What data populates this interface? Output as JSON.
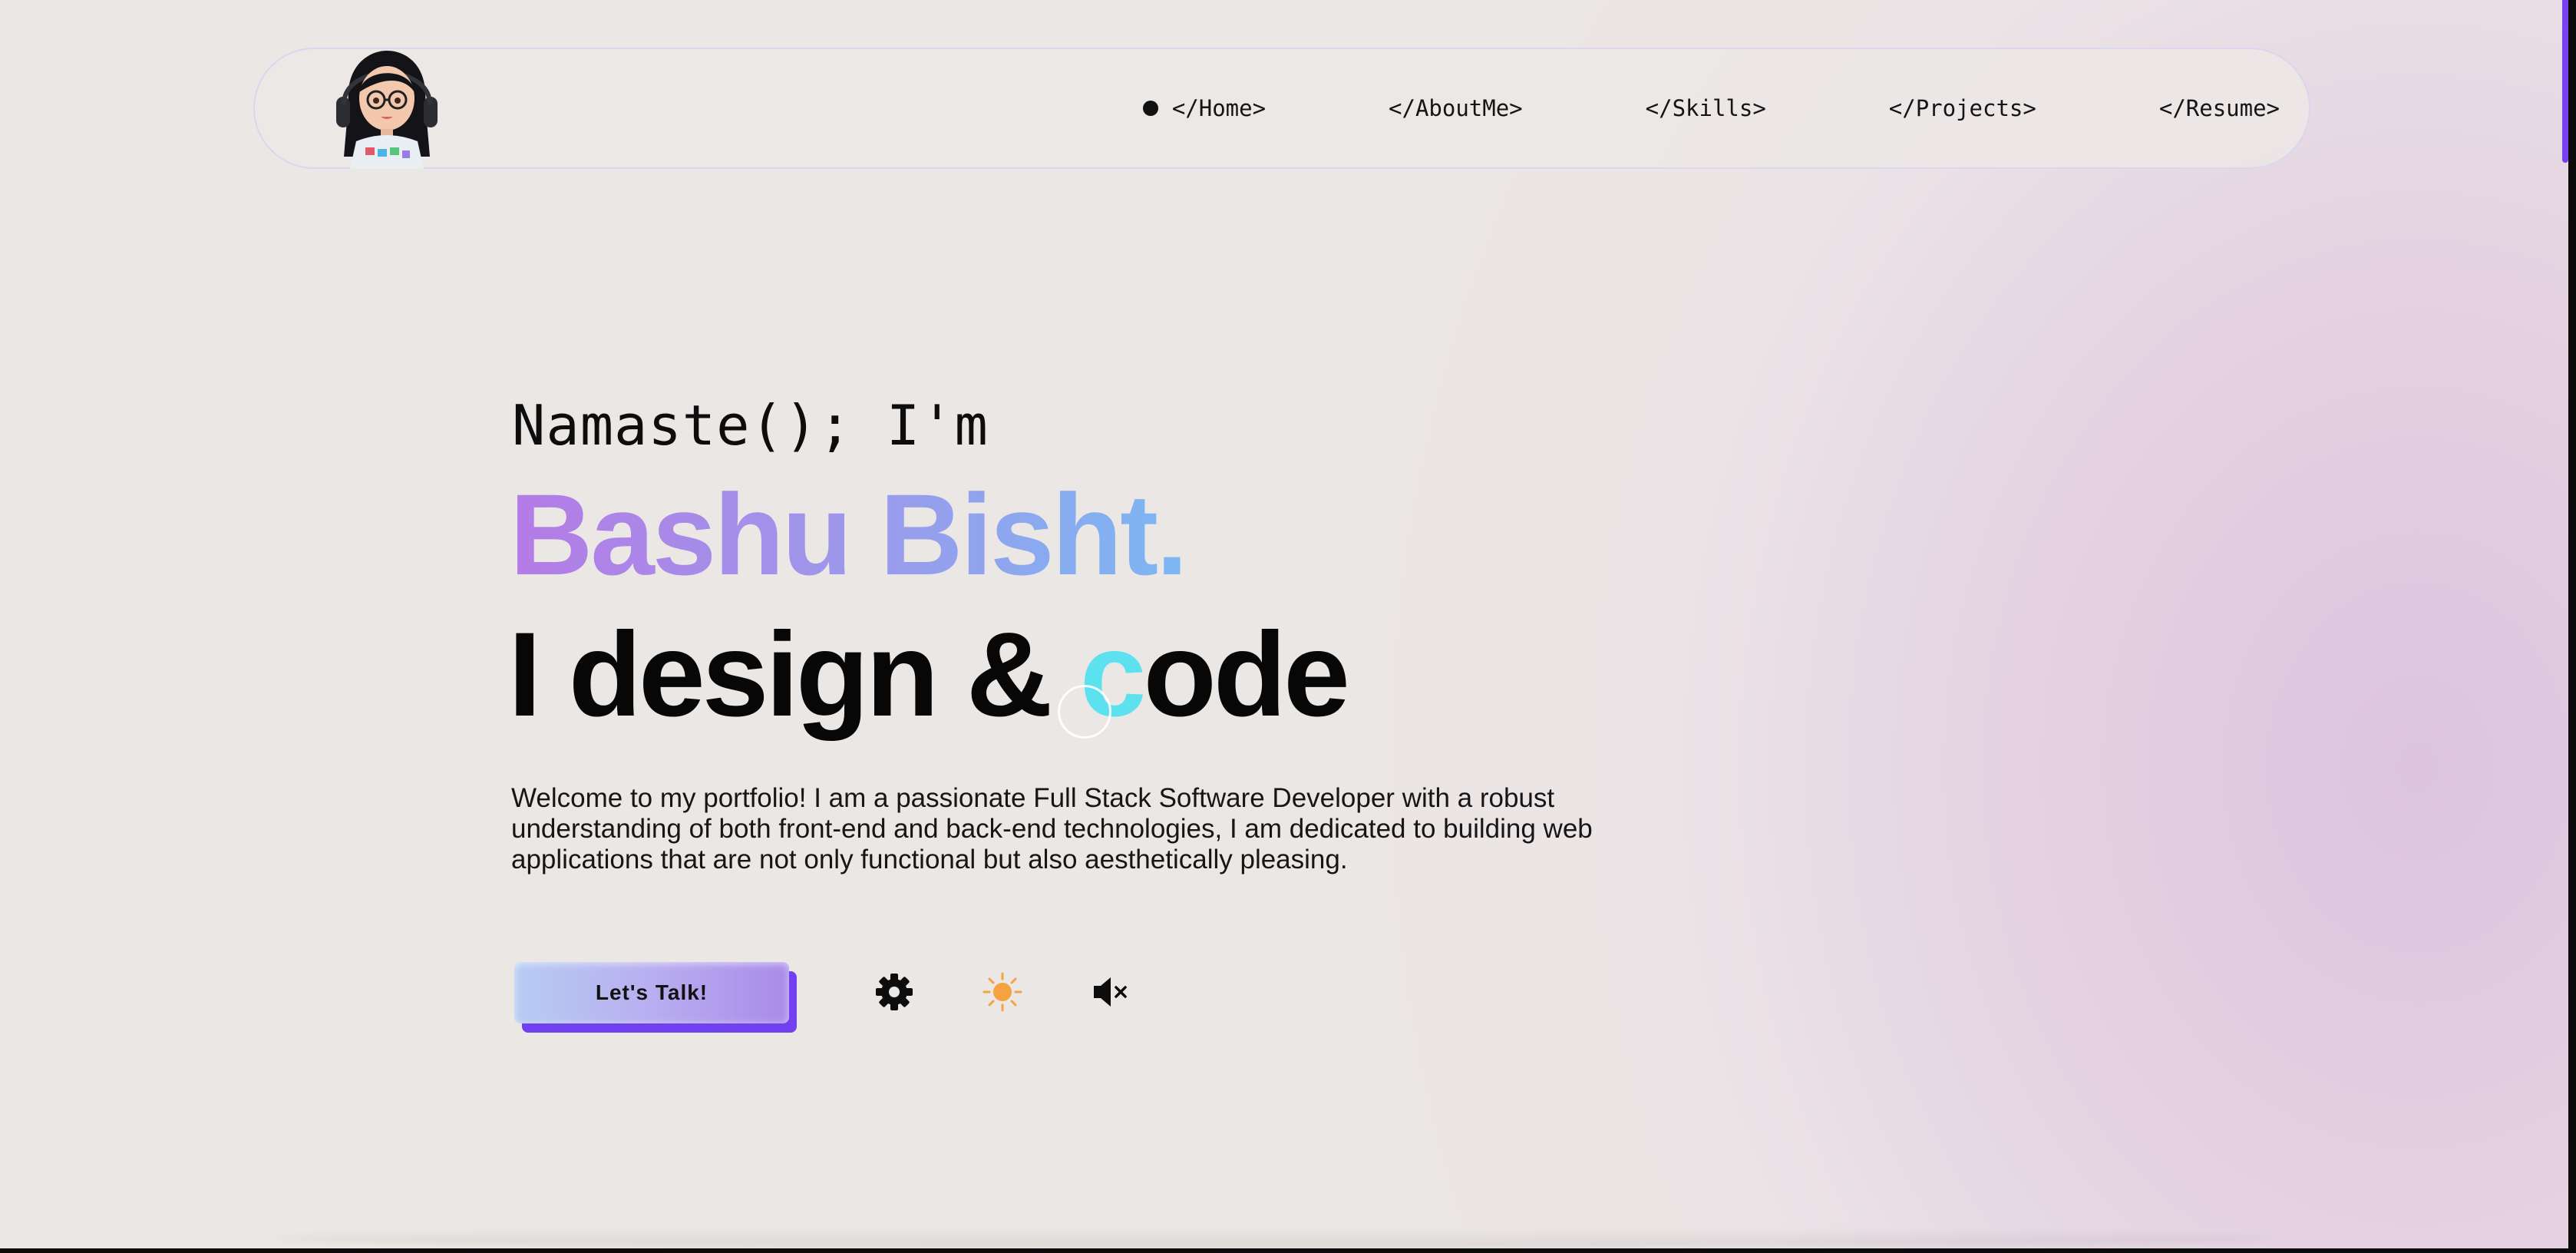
{
  "nav": {
    "links": [
      {
        "label": "</Home>",
        "active": true
      },
      {
        "label": "</AboutMe>",
        "active": false
      },
      {
        "label": "</Skills>",
        "active": false
      },
      {
        "label": "</Projects>",
        "active": false
      },
      {
        "label": "</Resume>",
        "active": false
      }
    ]
  },
  "hero": {
    "greeting": "Namaste(); I'm",
    "name": "Bashu Bisht.",
    "tagline_before": "I design & ",
    "tagline_highlight": "c",
    "tagline_after": "ode",
    "intro": "Welcome to my portfolio! I am a passionate Full Stack Software Developer with a robust understanding of both front-end and back-end technologies, I am dedicated to building web applications that are not only functional but also aesthetically pleasing."
  },
  "actions": {
    "cta_label": "Let's Talk!",
    "icons": [
      "gear-icon",
      "sun-icon",
      "speaker-muted-icon"
    ]
  },
  "colors": {
    "accent": "#7b3ff2",
    "name_gradient_start": "#b47be6",
    "name_gradient_end": "#7cb7f3",
    "highlight": "#5ce1ef",
    "sun": "#f4a340"
  }
}
